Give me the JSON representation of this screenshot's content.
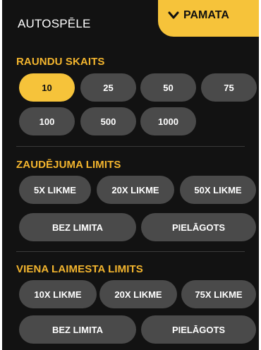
{
  "header": {
    "title": "AUTOSPĒLE",
    "basic_tab_label": "PAMATA"
  },
  "rounds": {
    "label": "RAUNDU SKAITS",
    "selected": "10",
    "options": [
      "10",
      "25",
      "50",
      "75",
      "100",
      "500",
      "1000"
    ]
  },
  "loss_limit": {
    "label": "ZAUDĒJUMA LIMITS",
    "options": [
      "5X LIKME",
      "20X LIKME",
      "50X LIKME",
      "BEZ LIMITA",
      "PIELĀGOTS"
    ]
  },
  "single_win_limit": {
    "label": "VIENA LAIMESTA LIMITS",
    "options": [
      "10X LIKME",
      "20X LIKME",
      "75X LIKME",
      "BEZ LIMITA",
      "PIELĀGOTS"
    ]
  },
  "colors": {
    "accent": "#f6c33a",
    "section_label": "#f3b52e",
    "panel_bg": "#121212",
    "pill_bg": "#4a4a4a"
  }
}
